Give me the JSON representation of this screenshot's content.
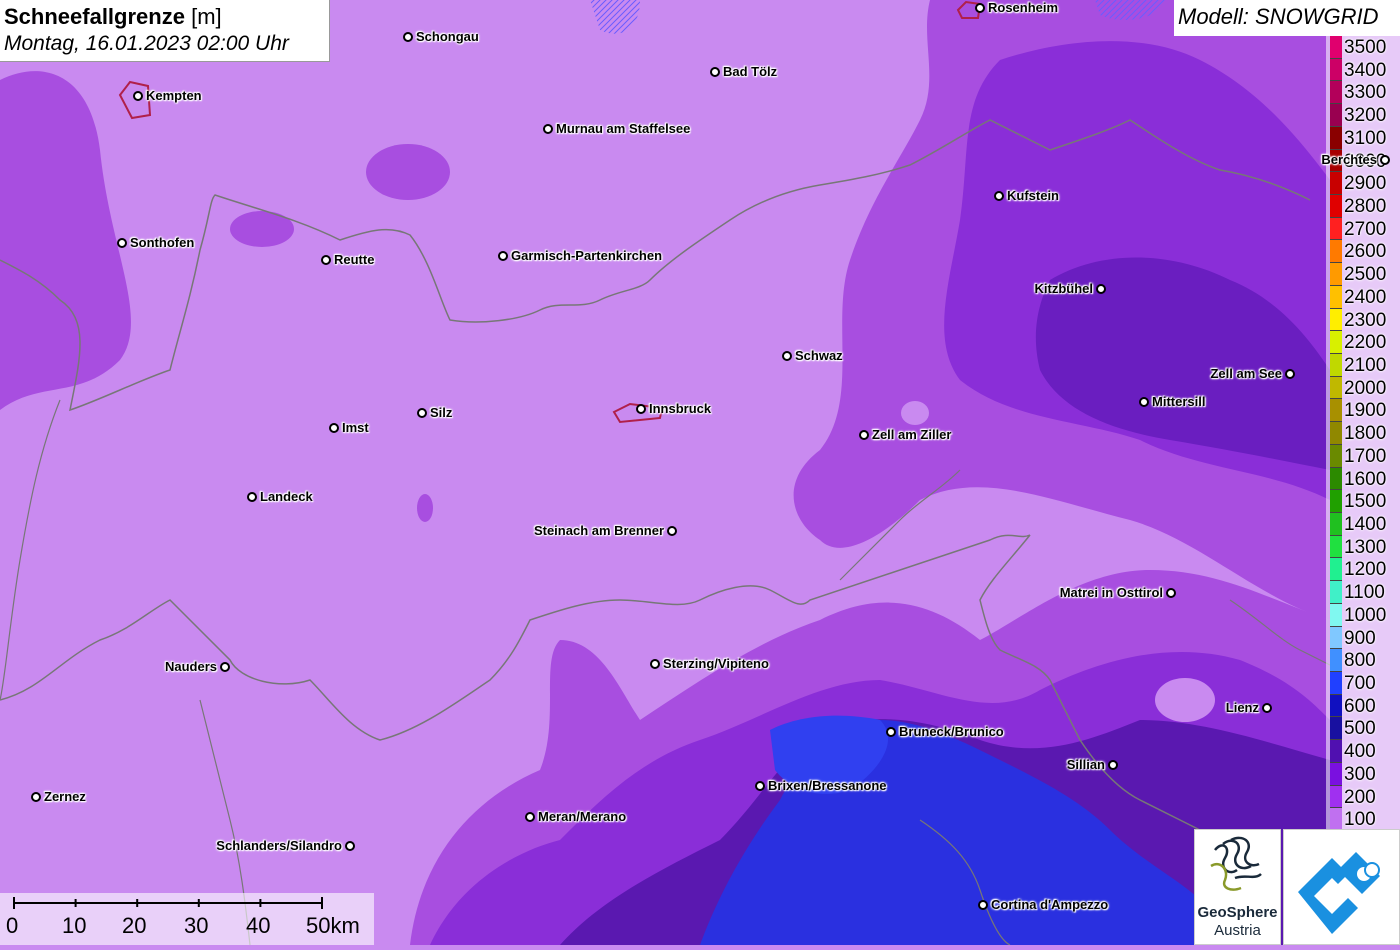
{
  "title": {
    "parameter": "Schneefallgrenze",
    "unit": "[m]",
    "datetime": "Montag, 16.01.2023 02:00 Uhr"
  },
  "model_label": "Modell: SNOWGRID",
  "legend": [
    {
      "label": "3500",
      "color": "#e0006e"
    },
    {
      "label": "3400",
      "color": "#cc0066"
    },
    {
      "label": "3300",
      "color": "#b3005a"
    },
    {
      "label": "3200",
      "color": "#990050"
    },
    {
      "label": "3100",
      "color": "#8a0000"
    },
    {
      "label": "3000",
      "color": "#a80000"
    },
    {
      "label": "2900",
      "color": "#c80000"
    },
    {
      "label": "2800",
      "color": "#e00000"
    },
    {
      "label": "2700",
      "color": "#ff2020"
    },
    {
      "label": "2600",
      "color": "#ff7a00"
    },
    {
      "label": "2500",
      "color": "#ff9a00"
    },
    {
      "label": "2400",
      "color": "#ffc000"
    },
    {
      "label": "2300",
      "color": "#ffee00"
    },
    {
      "label": "2200",
      "color": "#d8f000"
    },
    {
      "label": "2100",
      "color": "#c0d800"
    },
    {
      "label": "2000",
      "color": "#c0b800"
    },
    {
      "label": "1900",
      "color": "#a89000"
    },
    {
      "label": "1800",
      "color": "#908800"
    },
    {
      "label": "1700",
      "color": "#6a8a00"
    },
    {
      "label": "1600",
      "color": "#2c8a00"
    },
    {
      "label": "1500",
      "color": "#20a000"
    },
    {
      "label": "1400",
      "color": "#20c020"
    },
    {
      "label": "1300",
      "color": "#20e040"
    },
    {
      "label": "1200",
      "color": "#20f090"
    },
    {
      "label": "1100",
      "color": "#40f0c8"
    },
    {
      "label": "1000",
      "color": "#80f8f0"
    },
    {
      "label": "900",
      "color": "#80c8ff"
    },
    {
      "label": "800",
      "color": "#4090ff"
    },
    {
      "label": "700",
      "color": "#2040ff"
    },
    {
      "label": "600",
      "color": "#1010c0"
    },
    {
      "label": "500",
      "color": "#1810a0"
    },
    {
      "label": "400",
      "color": "#5010b0"
    },
    {
      "label": "300",
      "color": "#7a10e0"
    },
    {
      "label": "200",
      "color": "#a030f0"
    },
    {
      "label": "100",
      "color": "#c070f0"
    }
  ],
  "cities": [
    {
      "name": "Rosenheim",
      "side": "right"
    },
    {
      "name": "Schongau",
      "side": "right"
    },
    {
      "name": "Kempten",
      "side": "right"
    },
    {
      "name": "Bad Tölz",
      "side": "right"
    },
    {
      "name": "Murnau am Staffelsee",
      "side": "right"
    },
    {
      "name": "Berchtes",
      "side": "left"
    },
    {
      "name": "Kufstein",
      "side": "right"
    },
    {
      "name": "Sonthofen",
      "side": "right"
    },
    {
      "name": "Reutte",
      "side": "right"
    },
    {
      "name": "Garmisch-Partenkirchen",
      "side": "right"
    },
    {
      "name": "Kitzbühel",
      "side": "left"
    },
    {
      "name": "Schwaz",
      "side": "right"
    },
    {
      "name": "Zell am See",
      "side": "left"
    },
    {
      "name": "Mittersill",
      "side": "right"
    },
    {
      "name": "Innsbruck",
      "side": "right"
    },
    {
      "name": "Silz",
      "side": "right"
    },
    {
      "name": "Imst",
      "side": "right"
    },
    {
      "name": "Zell am Ziller",
      "side": "right"
    },
    {
      "name": "Landeck",
      "side": "right"
    },
    {
      "name": "Steinach am Brenner",
      "side": "left"
    },
    {
      "name": "Matrei in Osttirol",
      "side": "left"
    },
    {
      "name": "Nauders",
      "side": "left"
    },
    {
      "name": "Sterzing/Vipiteno",
      "side": "right"
    },
    {
      "name": "Lienz",
      "side": "left"
    },
    {
      "name": "Bruneck/Brunico",
      "side": "right"
    },
    {
      "name": "Sillian",
      "side": "left"
    },
    {
      "name": "Brixen/Bressanone",
      "side": "right"
    },
    {
      "name": "Zernez",
      "side": "right"
    },
    {
      "name": "Meran/Merano",
      "side": "right"
    },
    {
      "name": "Schlanders/Silandro",
      "side": "left"
    },
    {
      "name": "Cortina d'Ampezzo",
      "side": "right"
    }
  ],
  "scale_bar": {
    "labels": [
      "0",
      "10",
      "20",
      "30",
      "40",
      "50km"
    ]
  },
  "logos": {
    "geosphere_name": "GeoSphere",
    "geosphere_sub": "Austria"
  }
}
